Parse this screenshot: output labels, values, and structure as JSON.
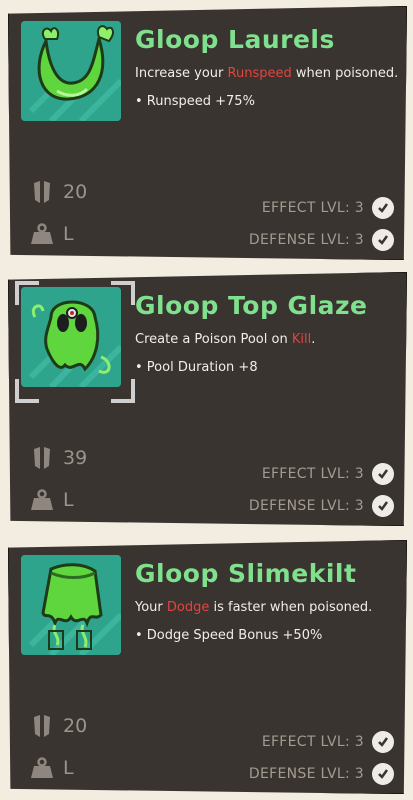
{
  "items": [
    {
      "title": "Gloop Laurels",
      "desc_before": "Increase your ",
      "desc_highlight": "Runspeed",
      "desc_after": " when poisoned.",
      "bonus": "• Runspeed +75%",
      "defense_value": "20",
      "weight_value": "L",
      "effect_label": "EFFECT LVL: 3",
      "defense_label": "DEFENSE LVL: 3",
      "icon": "laurels-icon"
    },
    {
      "title": "Gloop Top Glaze",
      "desc_before": "Create a Poison Pool on ",
      "desc_highlight": "Kill",
      "desc_after": ".",
      "bonus": "• Pool Duration +8",
      "defense_value": "39",
      "weight_value": "L",
      "effect_label": "EFFECT LVL: 3",
      "defense_label": "DEFENSE LVL: 3",
      "icon": "slime-helmet-icon"
    },
    {
      "title": "Gloop Slimekilt",
      "desc_before": "Your ",
      "desc_highlight": "Dodge",
      "desc_after": " is faster when poisoned.",
      "bonus": "• Dodge Speed Bonus +50%",
      "defense_value": "20",
      "weight_value": "L",
      "effect_label": "EFFECT LVL: 3",
      "defense_label": "DEFENSE LVL: 3",
      "icon": "slime-kilt-icon"
    }
  ],
  "colors": {
    "card_bg": "#39342f",
    "title_green": "#7fe08e",
    "highlight_red": "#e2443f",
    "thumb_teal": "#2fa48d"
  }
}
